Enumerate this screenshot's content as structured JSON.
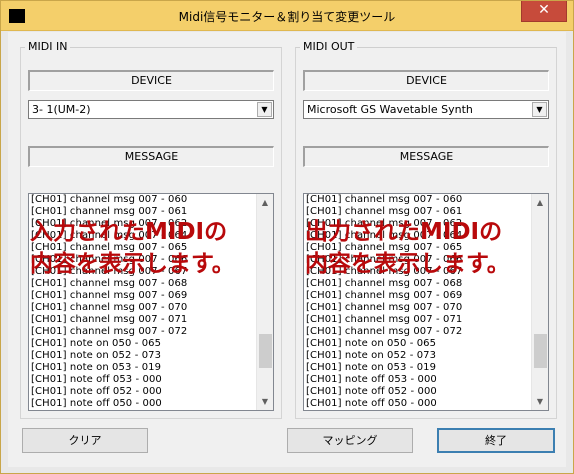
{
  "window": {
    "title": "Midi信号モニター＆割り当て変更ツール",
    "close_glyph": "✕"
  },
  "midi_in": {
    "group_label": "MIDI IN",
    "device_label": "DEVICE",
    "device_value": "3- 1(UM-2)",
    "message_label": "MESSAGE",
    "messages": [
      "[CH01] channel msg 007 - 060",
      "[CH01] channel msg 007 - 061",
      "[CH01] channel msg 007 - 062",
      "[CH01] channel msg 007 - 064",
      "[CH01] channel msg 007 - 065",
      "[CH01] channel msg 007 - 066",
      "[CH01] channel msg 007 - 067",
      "[CH01] channel msg 007 - 068",
      "[CH01] channel msg 007 - 069",
      "[CH01] channel msg 007 - 070",
      "[CH01] channel msg 007 - 071",
      "[CH01] channel msg 007 - 072",
      "[CH01] note on 050 - 065",
      "[CH01] note on 052 - 073",
      "[CH01] note on 053 - 019",
      "[CH01] note off 053 - 000",
      "[CH01] note off 052 - 000",
      "[CH01] note off 050 - 000"
    ],
    "annotation_line1": "入力されたMIDIの",
    "annotation_line2": "内容を表示します。"
  },
  "midi_out": {
    "group_label": "MIDI OUT",
    "device_label": "DEVICE",
    "device_value": "Microsoft GS Wavetable Synth",
    "message_label": "MESSAGE",
    "messages": [
      "[CH01] channel msg 007 - 060",
      "[CH01] channel msg 007 - 061",
      "[CH01] channel msg 007 - 062",
      "[CH01] channel msg 007 - 064",
      "[CH01] channel msg 007 - 065",
      "[CH01] channel msg 007 - 066",
      "[CH01] channel msg 007 - 067",
      "[CH01] channel msg 007 - 068",
      "[CH01] channel msg 007 - 069",
      "[CH01] channel msg 007 - 070",
      "[CH01] channel msg 007 - 071",
      "[CH01] channel msg 007 - 072",
      "[CH01] note on 050 - 065",
      "[CH01] note on 052 - 073",
      "[CH01] note on 053 - 019",
      "[CH01] note off 053 - 000",
      "[CH01] note off 052 - 000",
      "[CH01] note off 050 - 000"
    ],
    "annotation_line1": "出力されたMIDIの",
    "annotation_line2": "内容を表示します。"
  },
  "buttons": {
    "clear": "クリア",
    "mapping": "マッピング",
    "exit": "終了"
  },
  "icons": {
    "combo_arrow": "chevron-down-icon",
    "scroll_up": "scroll-up-arrow-icon",
    "scroll_down": "scroll-down-arrow-icon"
  },
  "colors": {
    "titlebar": "#f4cf6a",
    "close_button": "#c74b3b",
    "annotation_text": "#b8090b",
    "default_button_border": "#3c7fb1"
  }
}
